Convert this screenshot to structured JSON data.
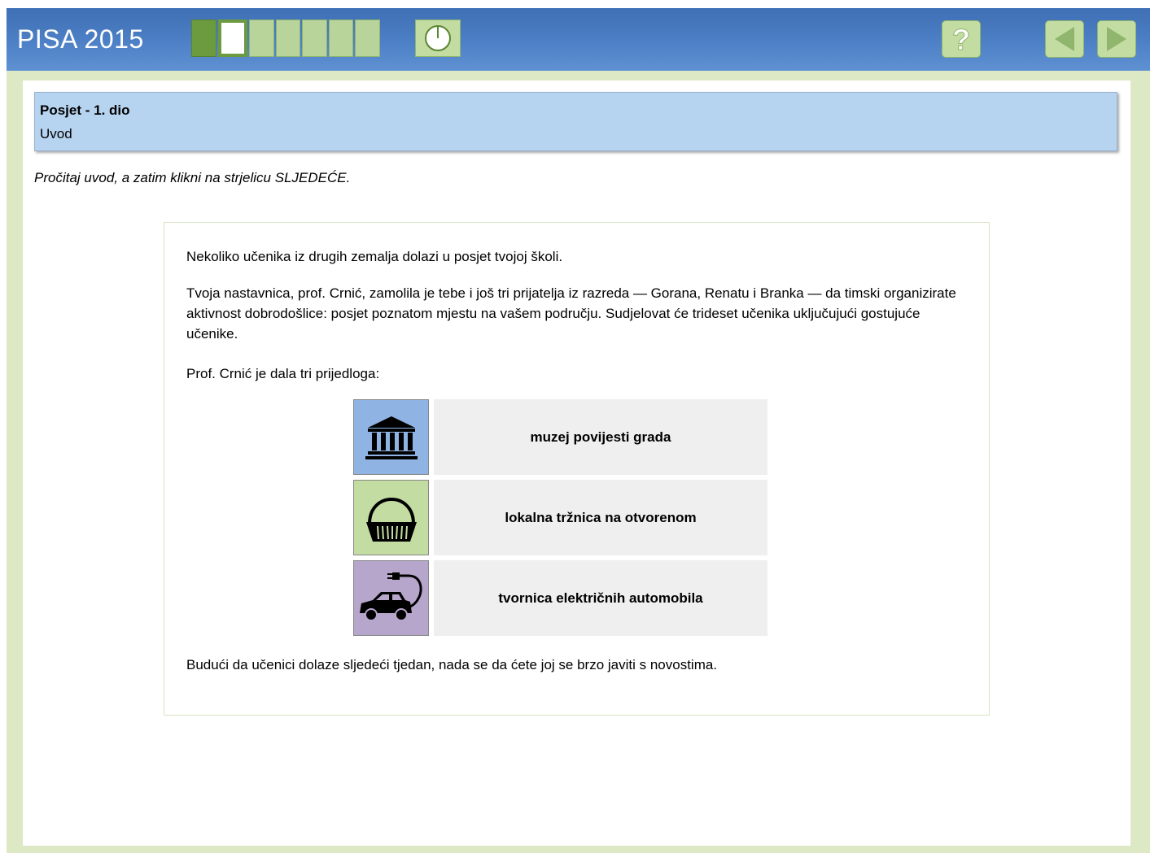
{
  "header": {
    "logo": "PISA 2015",
    "progress": {
      "total_segments": 7,
      "current_segment": 2
    },
    "help_label": "?"
  },
  "title": {
    "heading": "Posjet - 1. dio",
    "subheading": "Uvod"
  },
  "instruction": "Pročitaj uvod, a zatim klikni na strjelicu SLJEDEĆE.",
  "panel": {
    "paragraph1": "Nekoliko učenika iz drugih zemalja dolazi u posjet tvojoj školi.",
    "paragraph2": "Tvoja nastavnica, prof. Crnić, zamolila je tebe i još tri prijatelja iz razreda — Gorana, Renatu i Branka — da timski organizirate aktivnost dobrodošlice: posjet poznatom mjestu na vašem području. Sudjelovat će trideset učenika uključujući gostujuće učenike.",
    "paragraph3": "Prof. Crnić je dala tri prijedloga:",
    "options": [
      {
        "label": "muzej povijesti grada",
        "icon": "museum-icon",
        "color": "#8fb4e3"
      },
      {
        "label": "lokalna tržnica na otvorenom",
        "icon": "basket-icon",
        "color": "#c3dca2"
      },
      {
        "label": "tvornica električnih automobila",
        "icon": "electric-car-icon",
        "color": "#b7a6cc"
      }
    ],
    "paragraph4": "Budući da učenici dolaze sljedeći tjedan, nada se da ćete joj se brzo javiti s novostima."
  },
  "colors": {
    "header": "#4d80c6",
    "frame": "#dde8c4",
    "title_bar": "#b6d3f0",
    "progress_done": "#6c9a3e",
    "progress_todo": "#b8d49a"
  }
}
